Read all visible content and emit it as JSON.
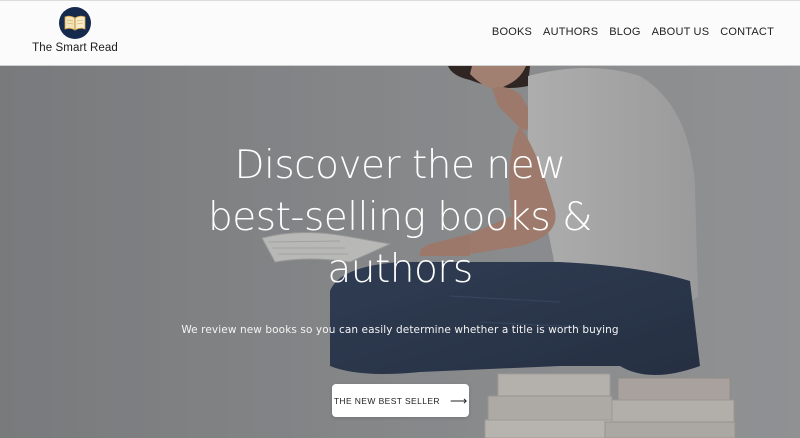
{
  "brand": {
    "name": "The Smart Read"
  },
  "nav": {
    "items": [
      {
        "label": "BOOKS"
      },
      {
        "label": "AUTHORS"
      },
      {
        "label": "BLOG"
      },
      {
        "label": "ABOUT US"
      },
      {
        "label": "CONTACT"
      }
    ]
  },
  "hero": {
    "headline_lines": [
      "Discover the new",
      "best-selling books &",
      "authors"
    ],
    "subtitle": "We review new books so you can easily determine whether a title is worth buying",
    "cta": {
      "label": "THE NEW BEST SELLER",
      "icon": "arrow-right-icon",
      "arrow": "⟶"
    }
  },
  "colors": {
    "logo_bg": "#152a4d",
    "header_bg": "#fbfbfb",
    "cta_bg": "#ffffff"
  }
}
